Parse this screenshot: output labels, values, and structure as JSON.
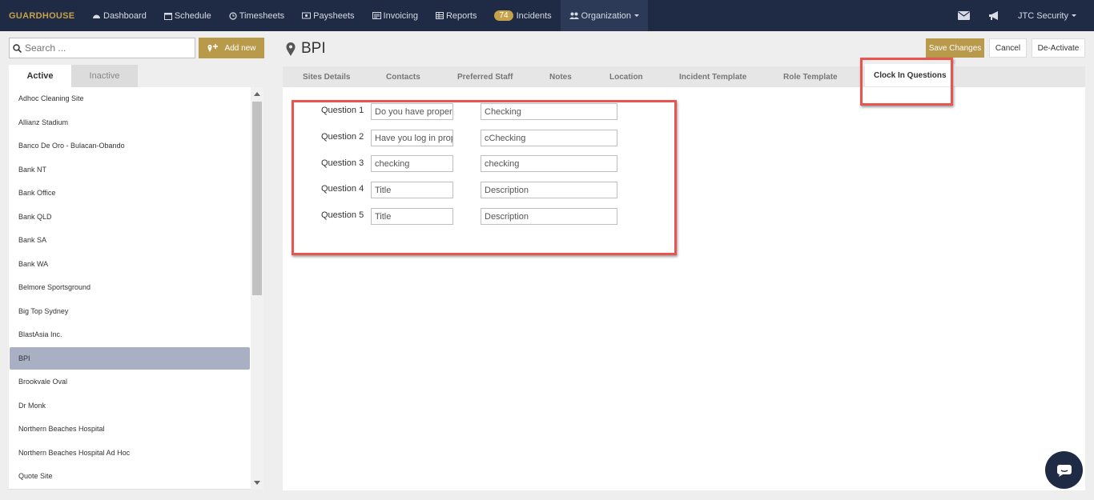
{
  "nav": {
    "brand": "GUARDHOUSE",
    "items": [
      {
        "label": "Dashboard",
        "icon": "dashboard-icon"
      },
      {
        "label": "Schedule",
        "icon": "calendar-icon"
      },
      {
        "label": "Timesheets",
        "icon": "clock-icon"
      },
      {
        "label": "Paysheets",
        "icon": "money-icon"
      },
      {
        "label": "Invoicing",
        "icon": "invoice-icon"
      },
      {
        "label": "Reports",
        "icon": "table-icon"
      },
      {
        "label": "Incidents",
        "badge": "74"
      },
      {
        "label": "Organization",
        "icon": "users-icon"
      }
    ],
    "user": "JTC Security"
  },
  "left": {
    "search_placeholder": "Search ...",
    "add_new": "Add new",
    "tabs": {
      "active": "Active",
      "inactive": "Inactive"
    },
    "sites": [
      "Adhoc Cleaning Site",
      "Allianz Stadium",
      "Banco De Oro - Bulacan-Obando",
      "Bank NT",
      "Bank Office",
      "Bank QLD",
      "Bank SA",
      "Bank WA",
      "Belmore Sportsground",
      "Big Top Sydney",
      "BlastAsia Inc.",
      "BPI",
      "Brookvale Oval",
      "Dr Monk",
      "Northern Beaches Hospital",
      "Northern Beaches Hospital Ad Hoc",
      "Quote Site"
    ],
    "selected_site": "BPI"
  },
  "page": {
    "title": "BPI",
    "save": "Save Changes",
    "cancel": "Cancel",
    "deactivate": "De-Activate"
  },
  "tabs": [
    "Sites Details",
    "Contacts",
    "Preferred Staff",
    "Notes",
    "Location",
    "Incident Template",
    "Role Template",
    "Clock In Questions"
  ],
  "questions": [
    {
      "label": "Question 1",
      "title": "Do you have proper",
      "description": "Checking"
    },
    {
      "label": "Question 2",
      "title": "Have you log in prop",
      "description": "cChecking"
    },
    {
      "label": "Question 3",
      "title": "checking",
      "description": "checking"
    },
    {
      "label": "Question 4",
      "title_placeholder": "Title",
      "description_placeholder": "Description"
    },
    {
      "label": "Question 5",
      "title_placeholder": "Title",
      "description_placeholder": "Description"
    }
  ],
  "colors": {
    "nav_bg": "#1f2a44",
    "accent_gold": "#b99a4b",
    "highlight_red": "#e8554e",
    "selected_row": "#a9b0c4"
  }
}
